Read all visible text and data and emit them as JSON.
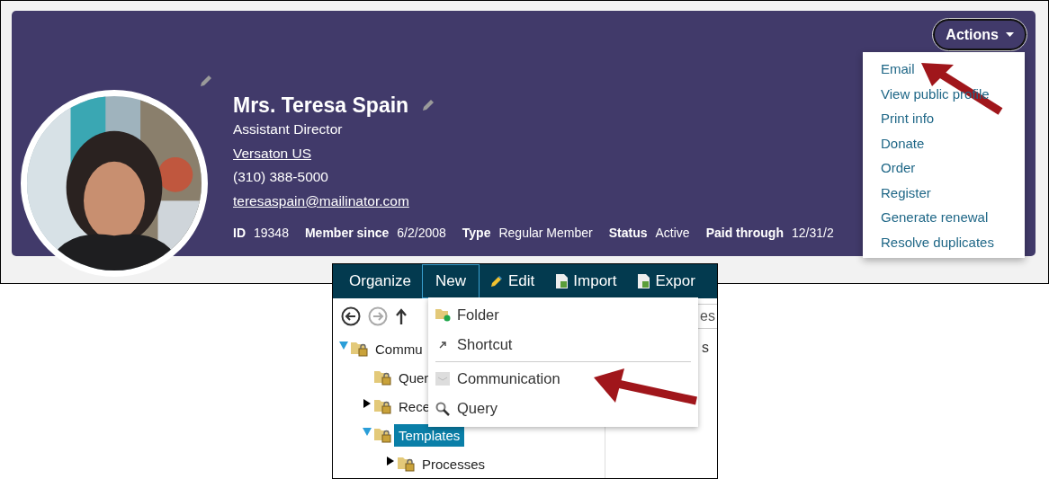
{
  "profile": {
    "name": "Mrs. Teresa Spain",
    "title": "Assistant Director",
    "company": "Versaton US",
    "phone": "(310) 388-5000",
    "email": "teresaspain@mailinator.com",
    "fields": [
      {
        "label": "ID",
        "value": "19348"
      },
      {
        "label": "Member since",
        "value": "6/2/2008"
      },
      {
        "label": "Type",
        "value": "Regular Member"
      },
      {
        "label": "Status",
        "value": "Active"
      },
      {
        "label": "Paid through",
        "value": "12/31/2"
      }
    ],
    "actions_button": "Actions",
    "actions_menu": [
      "Email",
      "View public profile",
      "Print info",
      "Donate",
      "Order",
      "Register",
      "Generate renewal",
      "Resolve duplicates"
    ]
  },
  "explorer": {
    "toolbar": [
      {
        "label": "Organize",
        "selected": false
      },
      {
        "label": "New",
        "selected": true
      },
      {
        "label": "Edit",
        "selected": false
      },
      {
        "label": "Import",
        "selected": false
      },
      {
        "label": "Expor",
        "selected": false
      }
    ],
    "path_field": "es",
    "right_pane": "s",
    "tree": [
      {
        "label": "Commu",
        "expanded": true,
        "selected": false,
        "children": [
          {
            "label": "Quer",
            "selected": false
          },
          {
            "label": "Rece",
            "expanded": false,
            "selected": false
          },
          {
            "label": "Templates",
            "expanded": true,
            "selected": true,
            "children": [
              {
                "label": "Processes",
                "expanded": false,
                "selected": false
              }
            ]
          }
        ]
      }
    ],
    "new_menu": [
      {
        "label": "Folder",
        "divider_before": false
      },
      {
        "label": "Shortcut",
        "divider_before": false
      },
      {
        "label": "Communication",
        "divider_before": true
      },
      {
        "label": "Query",
        "divider_before": false
      }
    ]
  }
}
